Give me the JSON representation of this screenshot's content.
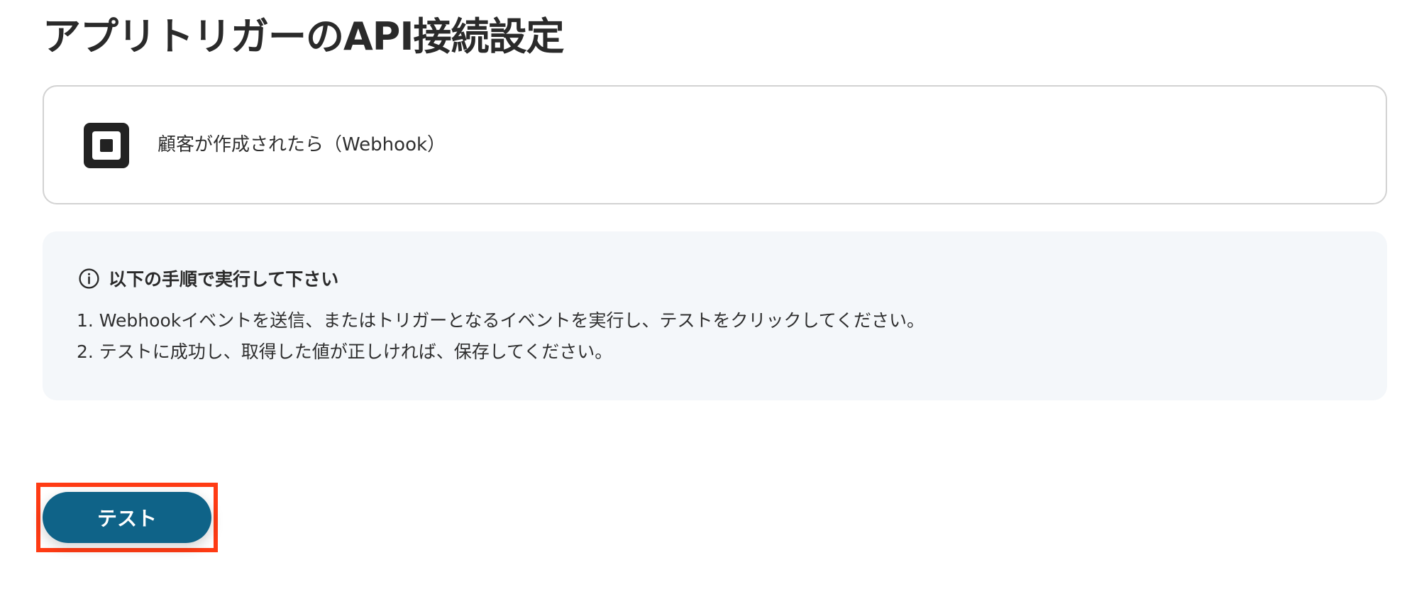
{
  "page": {
    "title": "アプリトリガーのAPI接続設定"
  },
  "trigger": {
    "icon": "square-logo-icon",
    "label": "顧客が作成されたら（Webhook）"
  },
  "instructions": {
    "icon": "info-circle-icon",
    "heading": "以下の手順で実行して下さい",
    "steps": [
      "1. Webhookイベントを送信、またはトリガーとなるイベントを実行し、テストをクリックしてください。",
      "2. テストに成功し、取得した値が正しければ、保存してください。"
    ]
  },
  "actions": {
    "test_label": "テスト",
    "button_color": "#0f6388",
    "highlight_color": "#ff3b14"
  }
}
